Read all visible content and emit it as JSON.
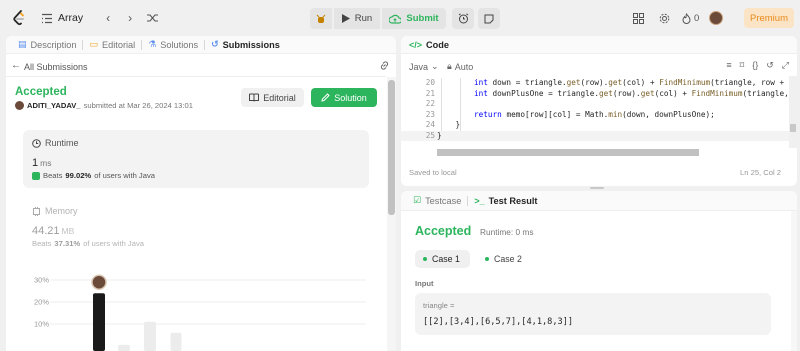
{
  "nav": {
    "problem_list_label": "Array",
    "run_label": "Run",
    "submit_label": "Submit",
    "streak_count": "0",
    "premium_label": "Premium"
  },
  "left_tabs": [
    {
      "label": "Description",
      "icon": "description-icon"
    },
    {
      "label": "Editorial",
      "icon": "editorial-icon"
    },
    {
      "label": "Solutions",
      "icon": "flask-icon"
    },
    {
      "label": "Submissions",
      "icon": "history-icon",
      "active": true
    }
  ],
  "submission": {
    "back_label": "All Submissions",
    "status": "Accepted",
    "username": "ADITI_YADAV_",
    "submitted_text": "submitted at Mar 26, 2024 13:01",
    "editorial_button": "Editorial",
    "solution_button": "Solution",
    "runtime": {
      "label": "Runtime",
      "value": "1",
      "unit": "ms",
      "beats_prefix": "Beats",
      "beats_pct": "99.02%",
      "beats_suffix": "of users with Java"
    },
    "memory": {
      "label": "Memory",
      "value": "44.21",
      "unit": "MB",
      "beats_prefix": "Beats",
      "beats_pct": "37.31%",
      "beats_suffix": "of users with Java"
    }
  },
  "chart_data": {
    "type": "bar",
    "yticks": [
      "30%",
      "20%",
      "10%"
    ],
    "ylim": [
      0,
      30
    ],
    "values": [
      24,
      0.5,
      11,
      6
    ],
    "highlight_index": 0
  },
  "code": {
    "header": "Code",
    "language": "Java",
    "autocomplete": "Auto",
    "lines": [
      {
        "num": "20",
        "text": "        int down = triangle.get(row).get(col) + FindMinimum(triangle, row + 1, c"
      },
      {
        "num": "21",
        "text": "        int downPlusOne = triangle.get(row).get(col) + FindMinimum(triangle, row"
      },
      {
        "num": "22",
        "text": ""
      },
      {
        "num": "23",
        "text": "        return memo[row][col] = Math.min(down, downPlusOne);"
      },
      {
        "num": "24",
        "text": "    }"
      },
      {
        "num": "25",
        "text": "}"
      }
    ],
    "saved_label": "Saved to local",
    "cursor_pos": "Ln 25, Col 2"
  },
  "test": {
    "tabs": [
      {
        "label": "Testcase",
        "icon": "checkbox-icon"
      },
      {
        "label": "Test Result",
        "icon": "terminal-icon",
        "active": true
      }
    ],
    "status": "Accepted",
    "runtime_text": "Runtime: 0 ms",
    "cases": [
      "Case 1",
      "Case 2"
    ],
    "input_label": "Input",
    "var_name": "triangle =",
    "var_value": "[[2],[3,4],[6,5,7],[4,1,8,3]]"
  },
  "colors": {
    "accent_green": "#2db55d",
    "premium_orange": "#e88a1a",
    "background": "#f0f0f0"
  }
}
